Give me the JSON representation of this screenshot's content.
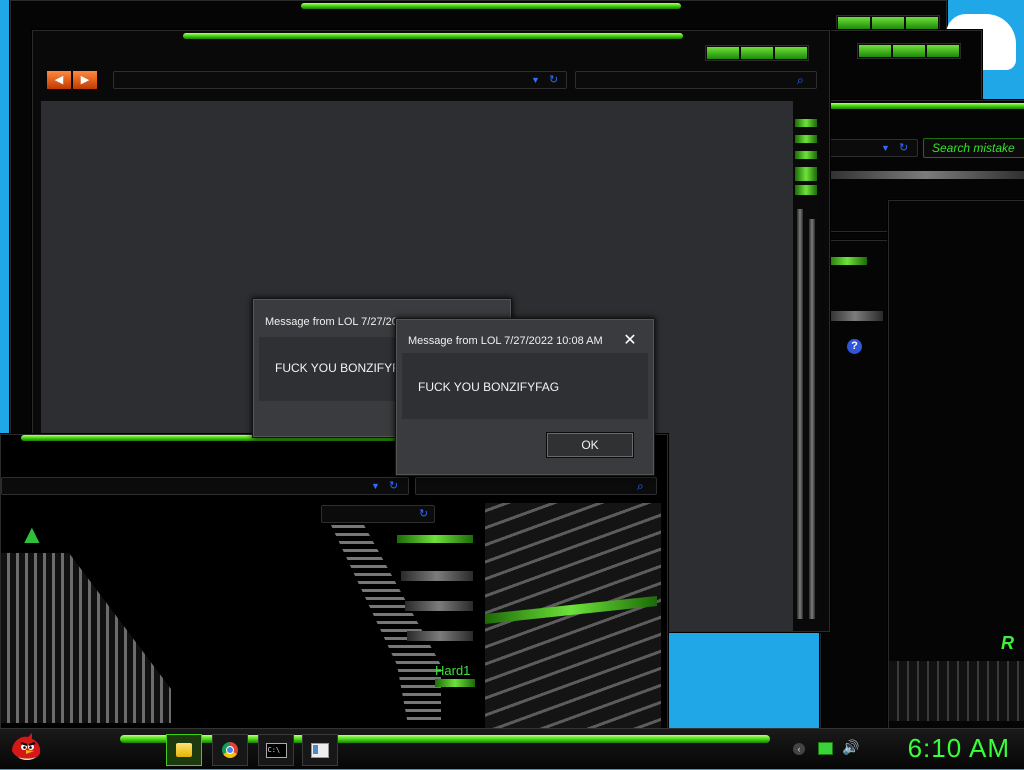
{
  "desktop": {
    "background_color": "#1fa7e8"
  },
  "back_window": {
    "search_placeholder": "Search mistake"
  },
  "label_hard": "Hard1",
  "dialog_back": {
    "title": "Message from LOL 7/27/20",
    "message": "FUCK YOU BONZIFYFAG"
  },
  "dialog_front": {
    "title": "Message from LOL 7/27/2022 10:08 AM",
    "message": "FUCK YOU BONZIFYFAG",
    "ok_label": "OK",
    "close_symbol": "✕"
  },
  "taskbar": {
    "clock": "6:10 AM",
    "icons": [
      "explorer-icon",
      "chrome-icon",
      "cmd-icon",
      "window-icon"
    ]
  },
  "colors": {
    "accent_green": "#3fd10f",
    "clock_green": "#39ff3a",
    "link_blue": "#2f6cff"
  }
}
